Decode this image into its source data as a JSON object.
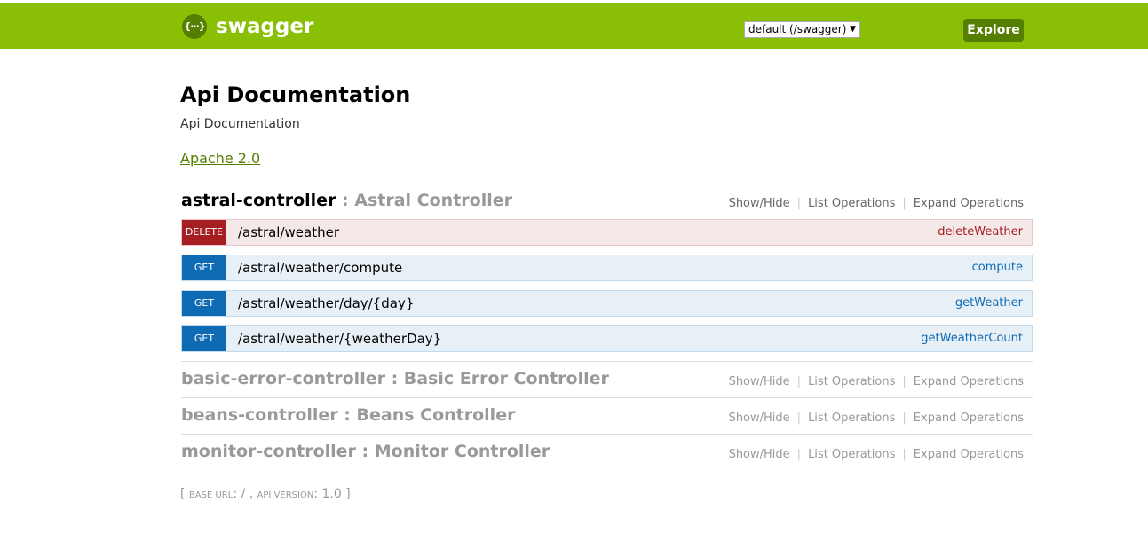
{
  "header": {
    "logo_text": "{···}",
    "brand": "swagger",
    "spec_select": "default (/swagger)",
    "explore_label": "Explore",
    "accent_color": "#89bf04"
  },
  "info": {
    "title": "Api Documentation",
    "description": "Api Documentation",
    "license": "Apache 2.0"
  },
  "controllers": [
    {
      "tag": "astral-controller",
      "separator": " : ",
      "description": "Astral Controller",
      "show_hide": "Show/Hide",
      "list_operations": "List Operations",
      "expand_operations": "Expand Operations",
      "operations": [
        {
          "method": "DELETE",
          "path": "/astral/weather",
          "nickname": "deleteWeather"
        },
        {
          "method": "GET",
          "path": "/astral/weather/compute",
          "nickname": "compute"
        },
        {
          "method": "GET",
          "path": "/astral/weather/day/{day}",
          "nickname": "getWeather"
        },
        {
          "method": "GET",
          "path": "/astral/weather/{weatherDay}",
          "nickname": "getWeatherCount"
        }
      ]
    },
    {
      "tag": "basic-error-controller",
      "separator": " : ",
      "description": "Basic Error Controller",
      "show_hide": "Show/Hide",
      "list_operations": "List Operations",
      "expand_operations": "Expand Operations"
    },
    {
      "tag": "beans-controller",
      "separator": " : ",
      "description": "Beans Controller",
      "show_hide": "Show/Hide",
      "list_operations": "List Operations",
      "expand_operations": "Expand Operations"
    },
    {
      "tag": "monitor-controller",
      "separator": " : ",
      "description": "Monitor Controller",
      "show_hide": "Show/Hide",
      "list_operations": "List Operations",
      "expand_operations": "Expand Operations"
    }
  ],
  "footer": {
    "open": "[ ",
    "base_url_label": "base url",
    "base_url_value": ": / , ",
    "api_version_label": "api version",
    "api_version_value": ": 1.0 ]"
  },
  "colors": {
    "delete": "#a41e22",
    "get": "#0f6ab4",
    "button": "#547f00"
  }
}
